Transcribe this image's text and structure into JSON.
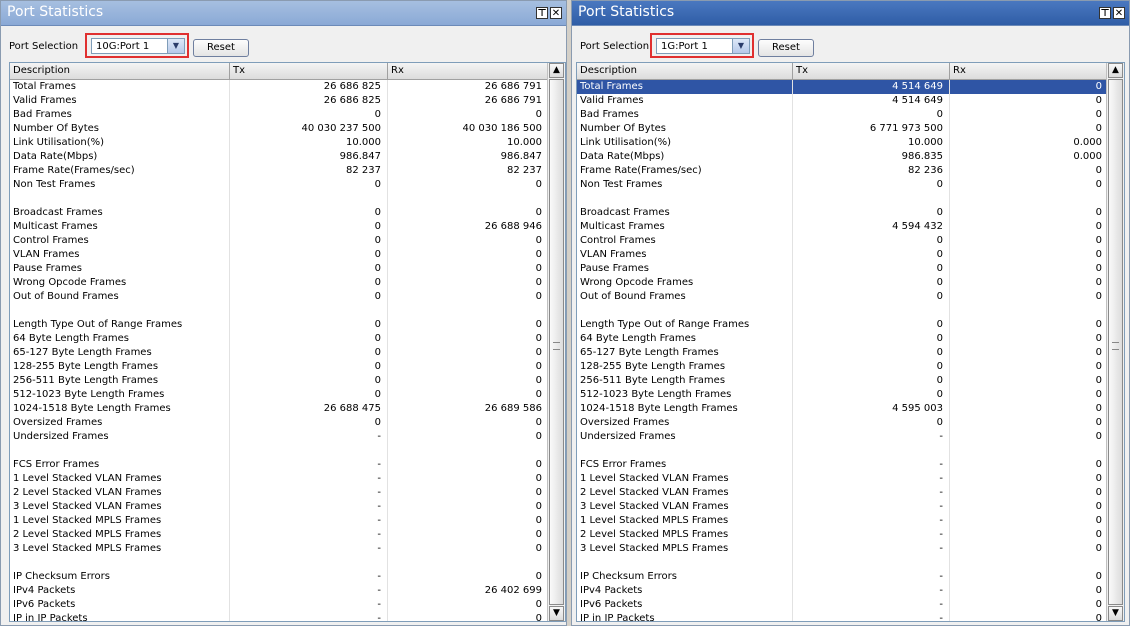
{
  "panels": [
    {
      "title": "Port Statistics",
      "port_label": "Port Selection",
      "port_value": "10G:Port 1",
      "reset_label": "Reset",
      "columns": [
        "Description",
        "Tx",
        "Rx"
      ],
      "rows": [
        [
          "Total Frames",
          "26 686 825",
          "26 686 791"
        ],
        [
          "Valid Frames",
          "26 686 825",
          "26 686 791"
        ],
        [
          "Bad Frames",
          "0",
          "0"
        ],
        [
          "Number Of Bytes",
          "40 030 237 500",
          "40 030 186 500"
        ],
        [
          "Link Utilisation(%)",
          "10.000",
          "10.000"
        ],
        [
          "Data Rate(Mbps)",
          "986.847",
          "986.847"
        ],
        [
          "Frame Rate(Frames/sec)",
          "82 237",
          "82 237"
        ],
        [
          "Non Test Frames",
          "0",
          "0"
        ],
        [
          "",
          "",
          ""
        ],
        [
          "Broadcast Frames",
          "0",
          "0"
        ],
        [
          "Multicast Frames",
          "0",
          "26 688 946"
        ],
        [
          "Control Frames",
          "0",
          "0"
        ],
        [
          "VLAN Frames",
          "0",
          "0"
        ],
        [
          "Pause Frames",
          "0",
          "0"
        ],
        [
          "Wrong Opcode Frames",
          "0",
          "0"
        ],
        [
          "Out of Bound Frames",
          "0",
          "0"
        ],
        [
          "",
          "",
          ""
        ],
        [
          "Length Type Out of Range Frames",
          "0",
          "0"
        ],
        [
          "64 Byte Length Frames",
          "0",
          "0"
        ],
        [
          "65-127 Byte Length Frames",
          "0",
          "0"
        ],
        [
          "128-255 Byte Length Frames",
          "0",
          "0"
        ],
        [
          "256-511 Byte Length Frames",
          "0",
          "0"
        ],
        [
          "512-1023 Byte Length Frames",
          "0",
          "0"
        ],
        [
          "1024-1518 Byte Length Frames",
          "26 688 475",
          "26 689 586"
        ],
        [
          "Oversized Frames",
          "0",
          "0"
        ],
        [
          "Undersized Frames",
          "-",
          "0"
        ],
        [
          "",
          "",
          ""
        ],
        [
          "FCS Error Frames",
          "-",
          "0"
        ],
        [
          "1 Level Stacked VLAN Frames",
          "-",
          "0"
        ],
        [
          "2 Level Stacked VLAN Frames",
          "-",
          "0"
        ],
        [
          "3 Level Stacked VLAN Frames",
          "-",
          "0"
        ],
        [
          "1 Level Stacked MPLS Frames",
          "-",
          "0"
        ],
        [
          "2 Level Stacked MPLS Frames",
          "-",
          "0"
        ],
        [
          "3 Level Stacked MPLS Frames",
          "-",
          "0"
        ],
        [
          "",
          "",
          ""
        ],
        [
          "IP Checksum Errors",
          "-",
          "0"
        ],
        [
          "IPv4 Packets",
          "-",
          "26 402 699"
        ],
        [
          "IPv6 Packets",
          "-",
          "0"
        ],
        [
          "IP in IP Packets",
          "-",
          "0"
        ]
      ]
    },
    {
      "title": "Port Statistics",
      "port_label": "Port Selection",
      "port_value": "1G:Port 1",
      "reset_label": "Reset",
      "columns": [
        "Description",
        "Tx",
        "Rx"
      ],
      "rows": [
        [
          "Total Frames",
          "4 514 649",
          "0"
        ],
        [
          "Valid Frames",
          "4 514 649",
          "0"
        ],
        [
          "Bad Frames",
          "0",
          "0"
        ],
        [
          "Number Of Bytes",
          "6 771 973 500",
          "0"
        ],
        [
          "Link Utilisation(%)",
          "10.000",
          "0.000"
        ],
        [
          "Data Rate(Mbps)",
          "986.835",
          "0.000"
        ],
        [
          "Frame Rate(Frames/sec)",
          "82 236",
          "0"
        ],
        [
          "Non Test Frames",
          "0",
          "0"
        ],
        [
          "",
          "",
          ""
        ],
        [
          "Broadcast Frames",
          "0",
          "0"
        ],
        [
          "Multicast Frames",
          "4 594 432",
          "0"
        ],
        [
          "Control Frames",
          "0",
          "0"
        ],
        [
          "VLAN Frames",
          "0",
          "0"
        ],
        [
          "Pause Frames",
          "0",
          "0"
        ],
        [
          "Wrong Opcode Frames",
          "0",
          "0"
        ],
        [
          "Out of Bound Frames",
          "0",
          "0"
        ],
        [
          "",
          "",
          ""
        ],
        [
          "Length Type Out of Range Frames",
          "0",
          "0"
        ],
        [
          "64 Byte Length Frames",
          "0",
          "0"
        ],
        [
          "65-127 Byte Length Frames",
          "0",
          "0"
        ],
        [
          "128-255 Byte Length Frames",
          "0",
          "0"
        ],
        [
          "256-511 Byte Length Frames",
          "0",
          "0"
        ],
        [
          "512-1023 Byte Length Frames",
          "0",
          "0"
        ],
        [
          "1024-1518 Byte Length Frames",
          "4 595 003",
          "0"
        ],
        [
          "Oversized Frames",
          "0",
          "0"
        ],
        [
          "Undersized Frames",
          "-",
          "0"
        ],
        [
          "",
          "",
          ""
        ],
        [
          "FCS Error Frames",
          "-",
          "0"
        ],
        [
          "1 Level Stacked VLAN Frames",
          "-",
          "0"
        ],
        [
          "2 Level Stacked VLAN Frames",
          "-",
          "0"
        ],
        [
          "3 Level Stacked VLAN Frames",
          "-",
          "0"
        ],
        [
          "1 Level Stacked MPLS Frames",
          "-",
          "0"
        ],
        [
          "2 Level Stacked MPLS Frames",
          "-",
          "0"
        ],
        [
          "3 Level Stacked MPLS Frames",
          "-",
          "0"
        ],
        [
          "",
          "",
          ""
        ],
        [
          "IP Checksum Errors",
          "-",
          "0"
        ],
        [
          "IPv4 Packets",
          "-",
          "0"
        ],
        [
          "IPv6 Packets",
          "-",
          "0"
        ],
        [
          "IP in IP Packets",
          "-",
          "0"
        ]
      ],
      "selected_row": 0
    }
  ],
  "icons": {
    "pin": "pin-icon",
    "close": "close-icon",
    "dropdown": "chevron-down-icon",
    "up": "scroll-up-icon",
    "down": "scroll-down-icon"
  }
}
